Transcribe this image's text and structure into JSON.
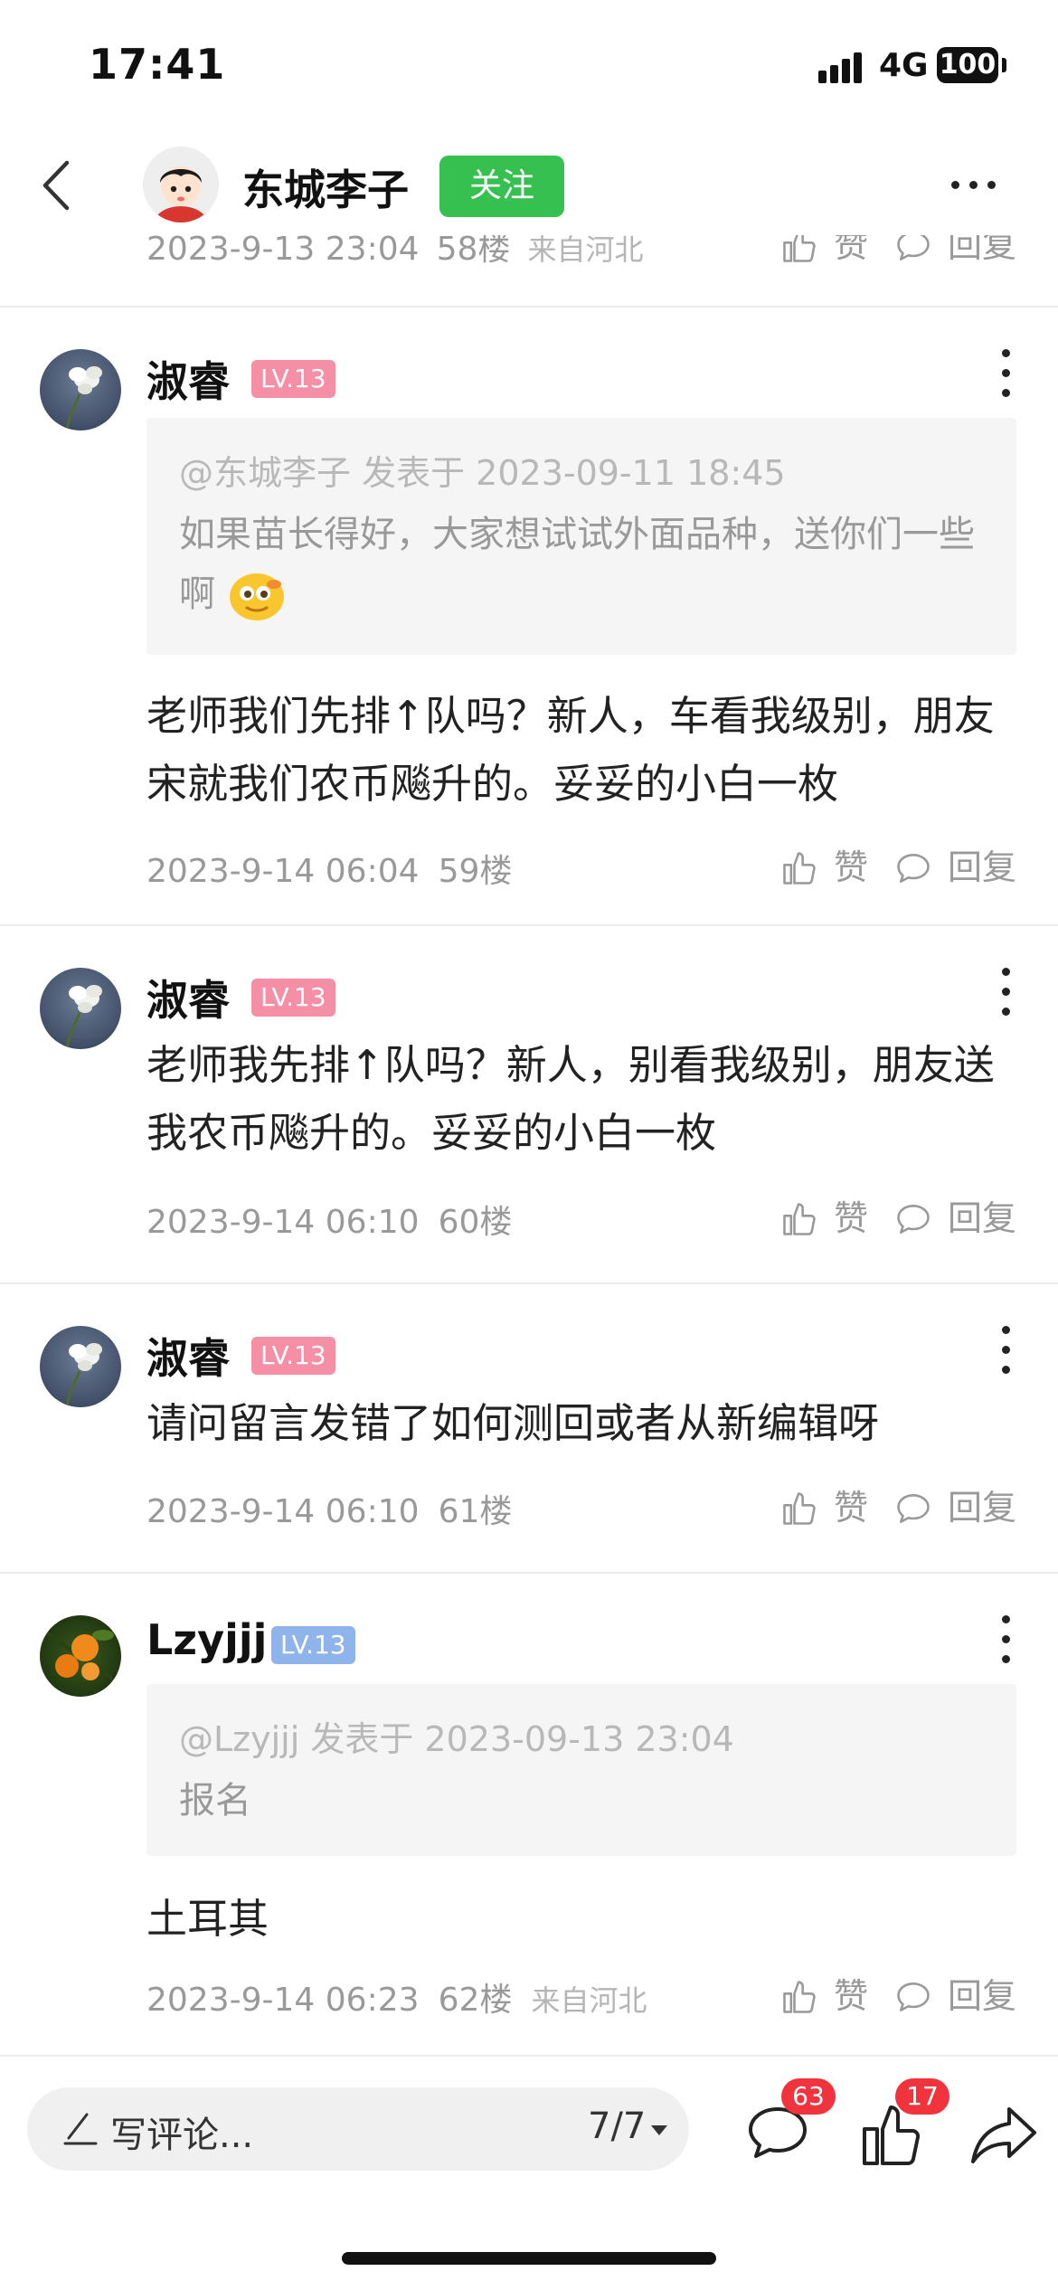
{
  "status_bar": {
    "time": "17:41",
    "network": "4G",
    "battery": "100"
  },
  "nav": {
    "title": "东城李子",
    "follow_label": "关注"
  },
  "partial_row": {
    "date": "2023-9-13 23:04",
    "floor": "58楼",
    "location": "来自河北",
    "like_label": "赞",
    "reply_label": "回复"
  },
  "comments": [
    {
      "name": "淑睿",
      "level": "LV.13",
      "quote": {
        "head": "@东城李子 发表于 2023-09-11 18:45",
        "body": "如果苗长得好，大家想试试外面品种，送你们一些啊"
      },
      "text": "老师我们先排↑队吗？新人，车看我级别，朋友宋就我们农币飚升的。妥妥的小白一枚",
      "date": "2023-9-14 06:04",
      "floor": "59楼",
      "location": "",
      "like_label": "赞",
      "reply_label": "回复"
    },
    {
      "name": "淑睿",
      "level": "LV.13",
      "text": "老师我先排↑队吗？新人，别看我级别，朋友送我农币飚升的。妥妥的小白一枚",
      "date": "2023-9-14 06:10",
      "floor": "60楼",
      "location": "",
      "like_label": "赞",
      "reply_label": "回复"
    },
    {
      "name": "淑睿",
      "level": "LV.13",
      "text": "请问留言发错了如何测回或者从新编辑呀",
      "date": "2023-9-14 06:10",
      "floor": "61楼",
      "location": "",
      "like_label": "赞",
      "reply_label": "回复"
    },
    {
      "name": "Lzyjjj",
      "level": "LV.13",
      "quote": {
        "head": "@Lzyjjj 发表于 2023-09-13 23:04",
        "body": "报名"
      },
      "text": "土耳其",
      "date": "2023-9-14 06:23",
      "floor": "62楼",
      "location": "来自河北",
      "like_label": "赞",
      "reply_label": "回复"
    }
  ],
  "bottom_bar": {
    "input_placeholder": "写评论...",
    "page_indicator": "7/7",
    "comment_count": "63",
    "like_count": "17"
  },
  "colors": {
    "follow": "#35c04f",
    "level_pink": "#f48fa5",
    "level_blue": "#8fb4ec",
    "badge_red": "#f0333c"
  },
  "icons": [
    "back-arrow-icon",
    "more-icon",
    "thumbs-up-icon",
    "comment-bubble-icon",
    "share-icon",
    "pencil-icon",
    "emoji-icon"
  ]
}
